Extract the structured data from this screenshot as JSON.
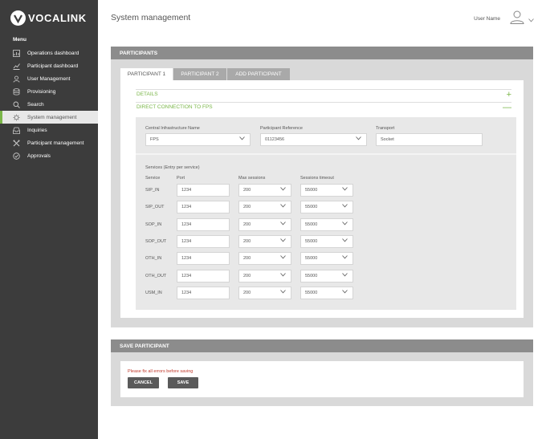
{
  "brand": {
    "name": "VOCALINK"
  },
  "sidebar": {
    "menu_title": "Menu",
    "items": [
      {
        "label": "Operations dashboard",
        "icon": "chart-icon"
      },
      {
        "label": "Participant dashboard",
        "icon": "trend-icon"
      },
      {
        "label": "User Management",
        "icon": "users-icon"
      },
      {
        "label": "Provisioning",
        "icon": "database-icon"
      },
      {
        "label": "Search",
        "icon": "search-icon"
      },
      {
        "label": "System management",
        "icon": "gear-icon",
        "active": true
      },
      {
        "label": "Inquiries",
        "icon": "inbox-icon"
      },
      {
        "label": "Participant management",
        "icon": "tools-icon"
      },
      {
        "label": "Approvals",
        "icon": "check-circle-icon"
      }
    ]
  },
  "header": {
    "title": "System management",
    "user_name": "User Name"
  },
  "participants_panel": {
    "title": "PARTICIPANTS",
    "tabs": [
      "PARTICIPANT 1",
      "PARTICIPANT 2",
      "ADD PARTICIPANT"
    ],
    "active_tab": "PARTICIPANT 1",
    "details": {
      "label": "DETAILS",
      "symbol": "+"
    },
    "connection": {
      "label": "DIRECT CONNECTION TO FPS",
      "symbol": "—"
    },
    "fields": {
      "cin_label": "Central Infrastructure Name",
      "cin_value": "FPS",
      "pref_label": "Participant Reference",
      "pref_value": "01123456",
      "transport_label": "Transport",
      "transport_value": "Socket"
    },
    "services": {
      "title": "Services (Entry per service)",
      "col_service": "Service",
      "col_port": "Port",
      "col_max": "Max sessions",
      "col_timeout": "Sessions timeout",
      "rows": [
        {
          "service": "SIP_IN",
          "port": "1234",
          "max": "200",
          "timeout": "55000"
        },
        {
          "service": "SIP_OUT",
          "port": "1234",
          "max": "200",
          "timeout": "55000"
        },
        {
          "service": "SOP_IN",
          "port": "1234",
          "max": "200",
          "timeout": "55000"
        },
        {
          "service": "SOP_OUT",
          "port": "1234",
          "max": "200",
          "timeout": "55000"
        },
        {
          "service": "OTH_IN",
          "port": "1234",
          "max": "200",
          "timeout": "55000"
        },
        {
          "service": "OTH_OUT",
          "port": "1234",
          "max": "200",
          "timeout": "55000"
        },
        {
          "service": "USM_IN",
          "port": "1234",
          "max": "200",
          "timeout": "55000"
        }
      ]
    }
  },
  "save_panel": {
    "title": "SAVE PARTICIPANT",
    "error": "Please fix all errors before saving",
    "cancel_label": "CANCEL",
    "save_label": "SAVE"
  },
  "colors": {
    "accent": "#7ab648",
    "sidebar": "#3c3c3c",
    "panel_header": "#8c8c8c",
    "error": "#c0392b"
  }
}
